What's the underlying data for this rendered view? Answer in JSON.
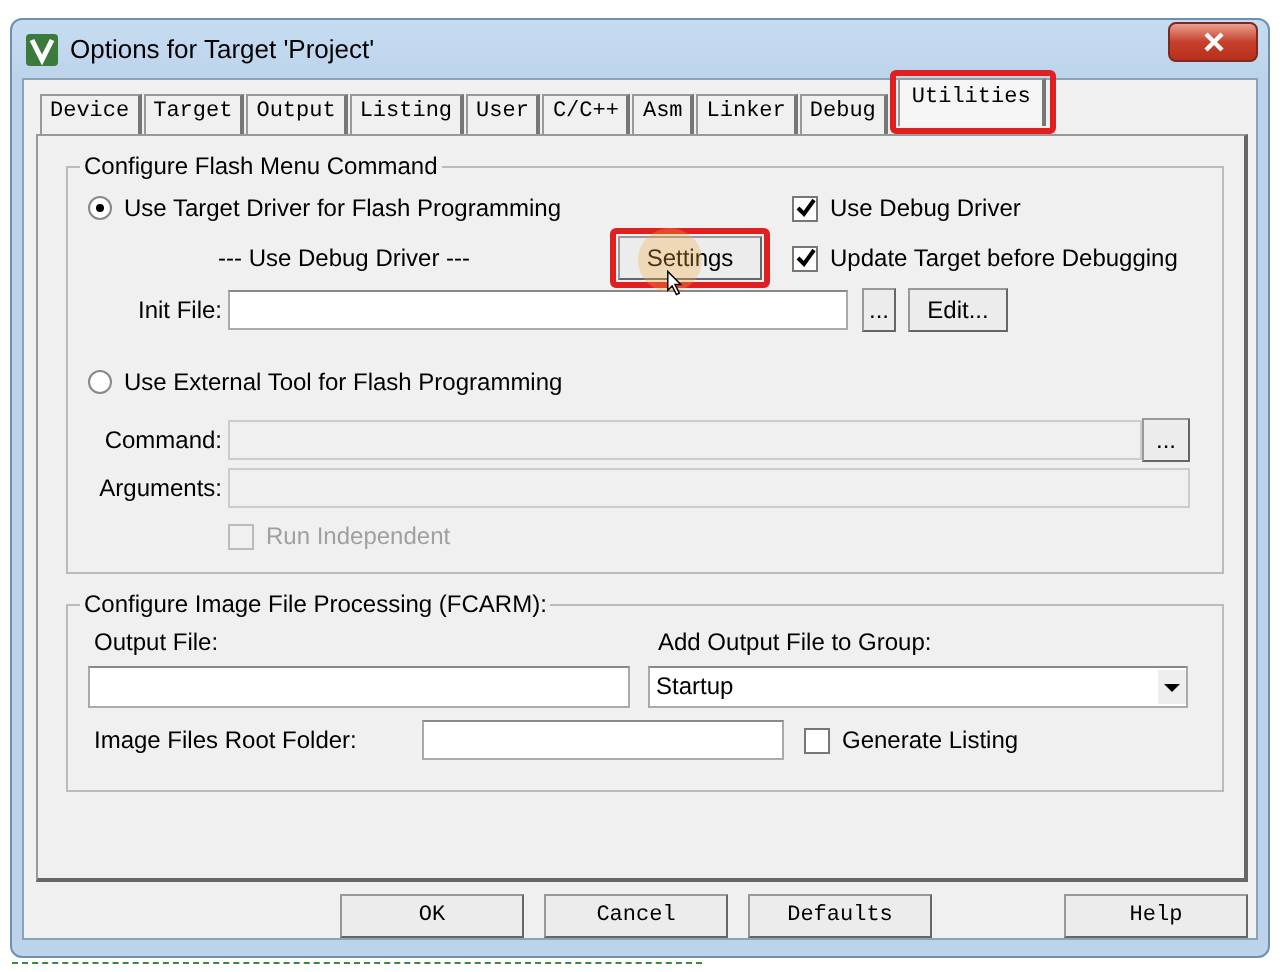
{
  "window": {
    "title": "Options for Target 'Project'"
  },
  "tabs": [
    {
      "label": "Device",
      "selected": false,
      "highlighted": false
    },
    {
      "label": "Target",
      "selected": false,
      "highlighted": false
    },
    {
      "label": "Output",
      "selected": false,
      "highlighted": false
    },
    {
      "label": "Listing",
      "selected": false,
      "highlighted": false
    },
    {
      "label": "User",
      "selected": false,
      "highlighted": false
    },
    {
      "label": "C/C++",
      "selected": false,
      "highlighted": false
    },
    {
      "label": "Asm",
      "selected": false,
      "highlighted": false
    },
    {
      "label": "Linker",
      "selected": false,
      "highlighted": false
    },
    {
      "label": "Debug",
      "selected": false,
      "highlighted": false
    },
    {
      "label": "Utilities",
      "selected": true,
      "highlighted": true
    }
  ],
  "flash_group": {
    "title": "Configure Flash Menu Command",
    "target_driver": {
      "label": "Use Target Driver for Flash Programming",
      "selected": true
    },
    "driver_name": "--- Use Debug Driver ---",
    "settings_button": {
      "label": "Settings",
      "highlighted": true
    },
    "use_debug_driver": {
      "label": "Use Debug Driver",
      "checked": true
    },
    "update_target": {
      "label": "Update Target before Debugging",
      "checked": true
    },
    "init_file": {
      "label": "Init File:",
      "browse": "...",
      "edit": "Edit..."
    },
    "external_tool": {
      "label": "Use External Tool for Flash Programming",
      "selected": false
    },
    "command": {
      "label": "Command:",
      "browse": "...",
      "disabled": true
    },
    "arguments": {
      "label": "Arguments:",
      "disabled": true
    },
    "run_independent": {
      "label": "Run Independent",
      "checked": false,
      "disabled": true
    }
  },
  "image_group": {
    "title": "Configure Image File Processing (FCARM):",
    "output_file": {
      "label": "Output File:"
    },
    "group": {
      "label": "Add Output File  to Group:",
      "value": "Startup"
    },
    "root_folder": {
      "label": "Image Files Root Folder:"
    },
    "generate_listing": {
      "label": "Generate Listing",
      "checked": false
    }
  },
  "buttons": [
    "OK",
    "Cancel",
    "Defaults",
    "Help"
  ]
}
